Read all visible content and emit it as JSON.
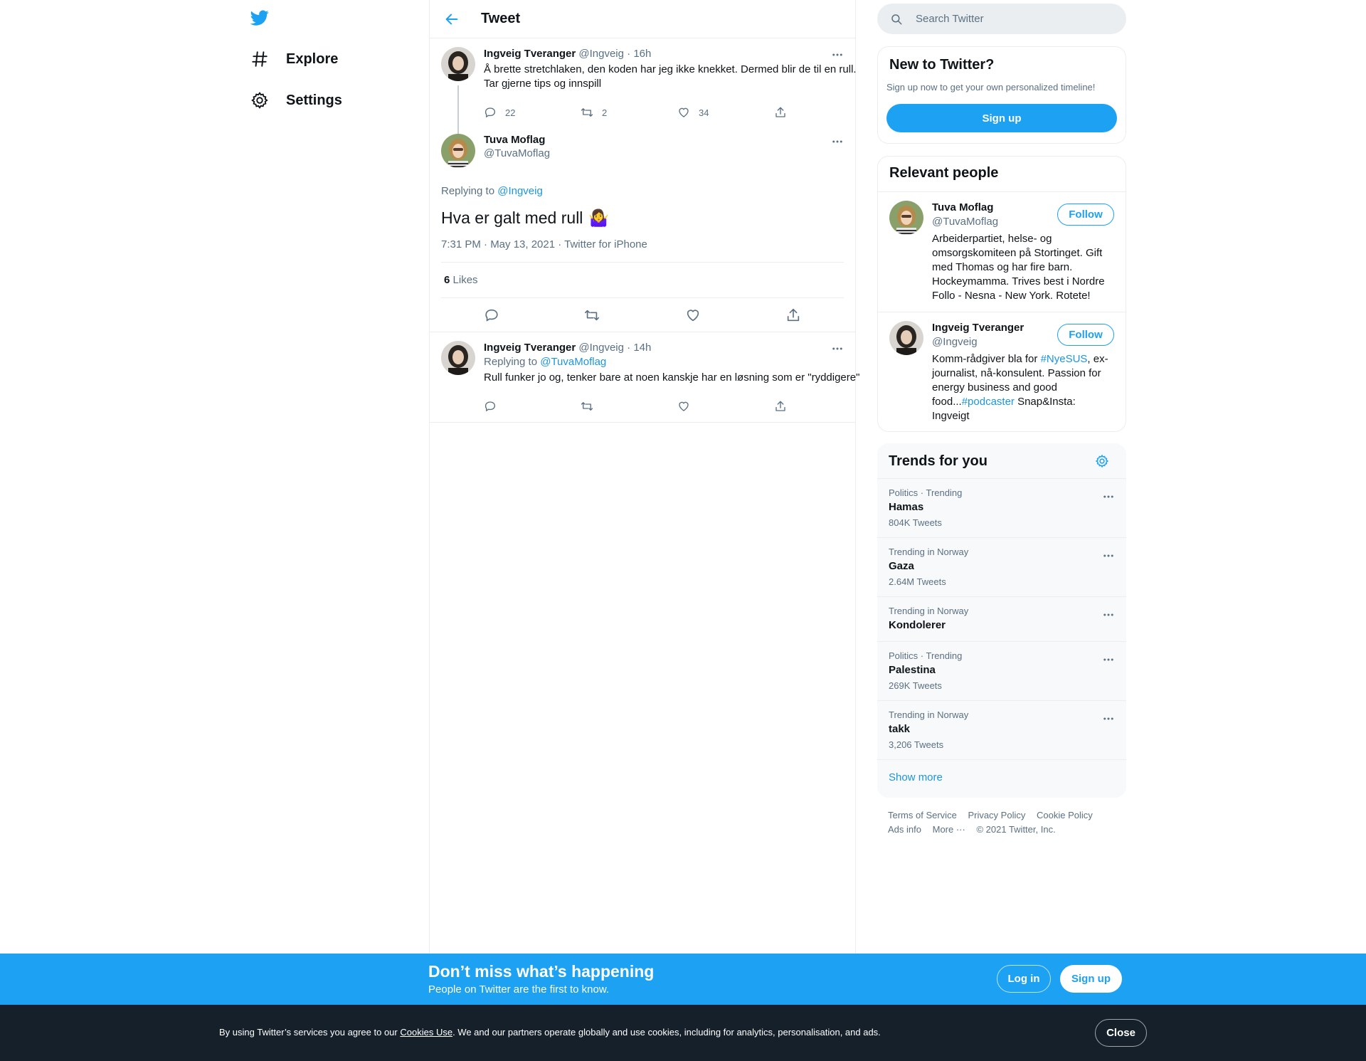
{
  "nav": {
    "items": [
      {
        "label": "Explore",
        "icon": "hashtag-icon"
      },
      {
        "label": "Settings",
        "icon": "gear-icon"
      }
    ]
  },
  "header": {
    "title": "Tweet"
  },
  "parent_tweet": {
    "name": "Ingveig Tveranger",
    "handle": "@Ingveig",
    "time": "· 16h",
    "text": "Å brette stretchlaken, den koden har jeg ikke knekket. Dermed blir de til en rull. Tar gjerne tips og innspill",
    "replies": "22",
    "retweets": "2",
    "likes": "34"
  },
  "focal_tweet": {
    "name": "Tuva Moflag",
    "handle": "@TuvaMoflag",
    "replying_prefix": "Replying to",
    "replying_handle": "@Ingveig",
    "text": "Hva er galt med rull",
    "emoji": "🤷‍♀️",
    "meta": "7:31 PM · May 13, 2021 · Twitter for iPhone",
    "likes_count": "6",
    "likes_label": "Likes"
  },
  "reply_tweet": {
    "name": "Ingveig Tveranger",
    "handle": "@Ingveig",
    "time": "· 14h",
    "replying_prefix": "Replying to",
    "replying_handle": "@TuvaMoflag",
    "text": "Rull funker jo og, tenker bare at noen kanskje har en løsning som er \"ryddigere\""
  },
  "search": {
    "placeholder": "Search Twitter"
  },
  "new_to_twitter": {
    "title": "New to Twitter?",
    "subtitle": "Sign up now to get your own personalized timeline!",
    "button": "Sign up"
  },
  "relevant_people": {
    "title": "Relevant people",
    "follow_label": "Follow",
    "people": [
      {
        "name": "Tuva Moflag",
        "handle": "@TuvaMoflag",
        "bio": "Arbeiderpartiet, helse- og omsorgskomiteen på Stortinget. Gift med Thomas og har fire barn. Hockeymamma. Trives best i Nordre Follo - Nesna - New York. Rotete!"
      },
      {
        "name": "Ingveig Tveranger",
        "handle": "@Ingveig",
        "bio_1": "Komm-rådgiver bla for ",
        "bio_tag1": "#NyeSUS",
        "bio_2": ", ex-journalist, nå-konsulent. Passion for energy business and good food...",
        "bio_tag2": "#podcaster",
        "bio_3": " Snap&Insta: Ingveigt"
      }
    ]
  },
  "trends": {
    "title": "Trends for you",
    "items": [
      {
        "context": "Politics · Trending",
        "name": "Hamas",
        "count": "804K Tweets"
      },
      {
        "context": "Trending in Norway",
        "name": "Gaza",
        "count": "2.64M Tweets"
      },
      {
        "context": "Trending in Norway",
        "name": "Kondolerer",
        "count": ""
      },
      {
        "context": "Politics · Trending",
        "name": "Palestina",
        "count": "269K Tweets"
      },
      {
        "context": "Trending in Norway",
        "name": "takk",
        "count": "3,206 Tweets"
      }
    ],
    "show_more": "Show more"
  },
  "footer": {
    "terms": "Terms of Service",
    "privacy": "Privacy Policy",
    "cookie": "Cookie Policy",
    "ads": "Ads info",
    "more": "More ···",
    "copyright": "© 2021 Twitter, Inc."
  },
  "signup_bar": {
    "heading": "Don’t miss what’s happening",
    "sub": "People on Twitter are the first to know.",
    "login": "Log in",
    "signup": "Sign up"
  },
  "cookie_bar": {
    "text_1": "By using Twitter’s services you agree to our ",
    "link": "Cookies Use",
    "text_2": ". We and our partners operate globally and use cookies, including for analytics, personalisation, and ads.",
    "close": "Close"
  },
  "colors": {
    "accent": "#1da1f2",
    "link": "#1b95e0",
    "muted": "#5b7083",
    "cookie_bg": "#15202b"
  }
}
